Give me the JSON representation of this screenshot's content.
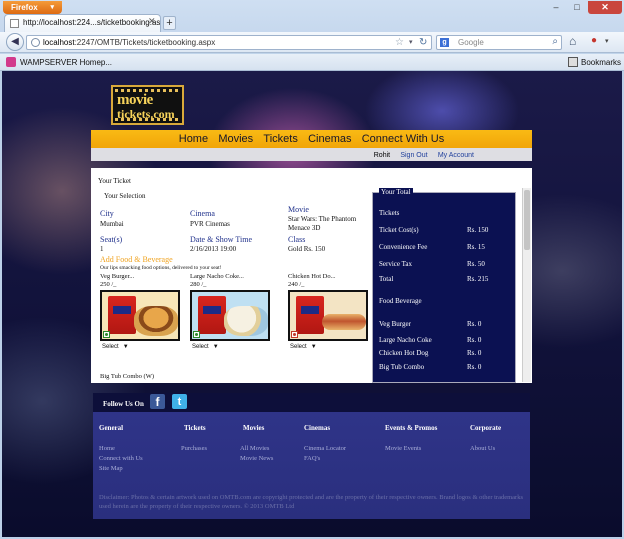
{
  "browser": {
    "app_button": "Firefox",
    "tab_title": "http://localhost:224...s/ticketbooking.aspx",
    "new_tab": "+",
    "url_host": "localhost",
    "url_rest": ":2247/OMTB/Tickets/ticketbooking.aspx",
    "search_engine": "Google",
    "search_placeholder": "Google",
    "bookmark_item": "WAMPSERVER Homep...",
    "bookmarks_label": "Bookmarks",
    "window_controls": {
      "minimize": "–",
      "maximize": "□",
      "close": "✕"
    }
  },
  "site": {
    "logo_line1": "movie",
    "logo_line2": "tickets.com",
    "menu": [
      "Home",
      "Movies",
      "Tickets",
      "Cinemas",
      "Connect With Us"
    ],
    "user_name": "Rohit",
    "sign_out": "Sign Out",
    "my_account": "My Account"
  },
  "ticket": {
    "section_title": "Your Ticket",
    "selection_title": "Your Selection",
    "city_label": "City",
    "city_value": "Mumbai",
    "cinema_label": "Cinema",
    "cinema_value": "PVR Cinemas",
    "movie_label": "Movie",
    "movie_value_line1": "Star Wars: The Phantom",
    "movie_value_line2": "Menace 3D",
    "seats_label": "Seat(s)",
    "seats_value": "1",
    "datetime_label": "Date & Show Time",
    "datetime_value": "2/16/2013 19:00",
    "class_label": "Class",
    "class_value": "Gold Rs. 150",
    "addfood_label": "Add Food & Beverage",
    "addfood_desc": "Our lips smacking food options, delivered to your seat!",
    "foods": [
      {
        "name": "Veg Burger...",
        "price": "250 /_",
        "select": "Select"
      },
      {
        "name": "Large Nacho Coke...",
        "price": "280 /_",
        "select": "Select"
      },
      {
        "name": "Chicken Hot Do...",
        "price": "240 /_",
        "select": "Select"
      }
    ],
    "next_item": "Big Tub Combo (W)"
  },
  "total": {
    "legend": "Your Total",
    "tickets": "Tickets",
    "ticket_cost_label": "Ticket Cost(s)",
    "ticket_cost_value": "Rs. 150",
    "conv_fee_label": "Convenience Fee",
    "conv_fee_value": "Rs. 15",
    "service_tax_label": "Service Tax",
    "service_tax_value": "Rs. 50",
    "total_label": "Total",
    "total_value": "Rs. 215",
    "food_bev": "Food Beverage",
    "veg_burger_label": "Veg Burger",
    "veg_burger_value": "Rs. 0",
    "nacho_label": "Large Nacho Coke",
    "nacho_value": "Rs. 0",
    "hotdog_label": "Chicken Hot Dog",
    "hotdog_value": "Rs. 0",
    "bigtub_label": "Big Tub Combo",
    "bigtub_value": "Rs. 0"
  },
  "footer": {
    "follow_us": "Follow Us On",
    "facebook": "f",
    "twitter": "t",
    "columns": [
      {
        "heading": "General",
        "links": [
          "Home",
          "Connect with Us",
          "Site Map"
        ]
      },
      {
        "heading": "Tickets",
        "links": [
          "Purchases"
        ]
      },
      {
        "heading": "Movies",
        "links": [
          "All Movies",
          "Movie News"
        ]
      },
      {
        "heading": "Cinemas",
        "links": [
          "Cinema Locator",
          "FAQ's"
        ]
      },
      {
        "heading": "Events & Promos",
        "links": [
          "Movie Events"
        ]
      },
      {
        "heading": "Corporate",
        "links": [
          "About Us"
        ]
      }
    ],
    "disclaimer": "Disclaimer: Photos & certain artwork used on OMTB.com are copyright protected and are the property of their respective owners. Brand logos & other trademarks used herein are the property of their respective owners. © 2013 OMTB Ltd"
  },
  "colors": {
    "menu_bar": "#f1a508",
    "total_panel": "#0b1152",
    "footer": "#2f3488",
    "link_blue": "#1f3f9c"
  }
}
